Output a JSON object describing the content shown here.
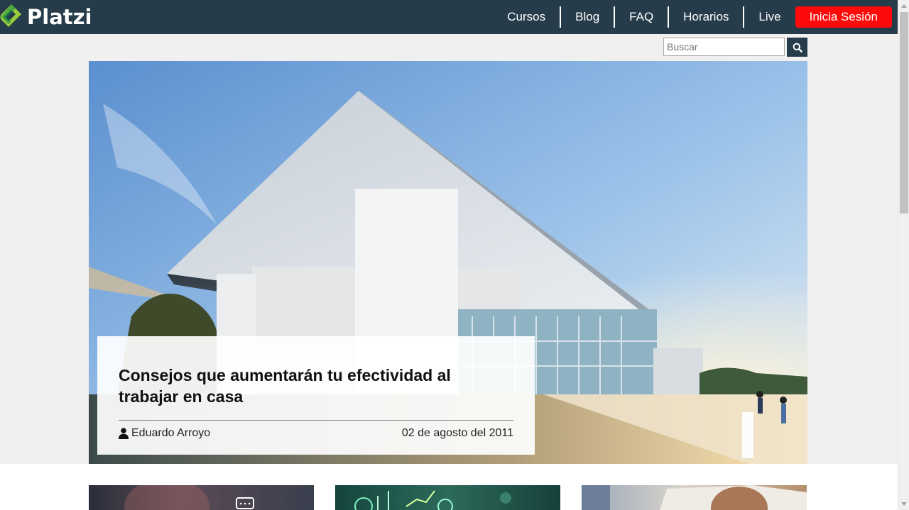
{
  "header": {
    "logo_text": "Platzi",
    "nav": [
      "Cursos",
      "Blog",
      "FAQ",
      "Horarios",
      "Live"
    ],
    "login_label": "Inicia Sesión"
  },
  "search": {
    "placeholder": "Buscar",
    "icon": "search-icon"
  },
  "featured": {
    "title": "Consejos que aumentarán tu efectividad al trabajar en casa",
    "author": "Eduardo Arroyo",
    "date": "02 de agosto del 2011",
    "author_icon": "user-icon"
  },
  "colors": {
    "header_bg": "#263c4a",
    "login_bg": "#ff0a0a",
    "logo_green": "#98ca3f"
  }
}
